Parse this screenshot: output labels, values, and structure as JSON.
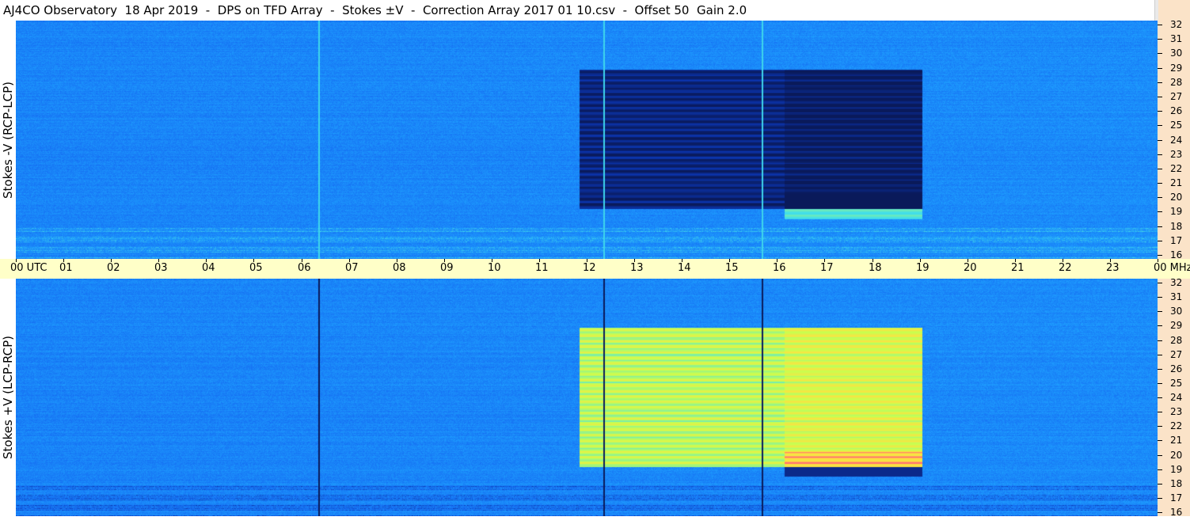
{
  "title": "AJ4CO Observatory  18 Apr 2019  -  DPS on TFD Array  -  Stokes ±V  -  Correction Array 2017 01 10.csv  -  Offset 50  Gain 2.0",
  "chart_data": [
    {
      "type": "heatmap",
      "name": "Stokes -V (RCP-LCP)",
      "ylabel": "Stokes -V (RCP-LCP)",
      "x_unit": "UTC",
      "y_unit": "MHz",
      "xlim": [
        0,
        24
      ],
      "ylim": [
        16,
        32
      ],
      "colormap": [
        "#0a1a5a",
        "#0b35b0",
        "#1465f0",
        "#1ea0ff",
        "#44e0e8",
        "#c8ff50",
        "#ffe040",
        "#ff3c8c"
      ],
      "events": [
        {
          "kind": "storm-block",
          "t_start": 11.85,
          "t_end": 19.05,
          "f_low": 19.2,
          "f_high": 28.9,
          "polarity": "negative"
        },
        {
          "kind": "storm-block-intense",
          "t_start": 16.15,
          "t_end": 19.05,
          "f_low": 18.5,
          "f_high": 28.9,
          "polarity": "negative"
        },
        {
          "kind": "vertical-line",
          "t": 6.35
        },
        {
          "kind": "vertical-line",
          "t": 12.35
        },
        {
          "kind": "vertical-line",
          "t": 15.68
        }
      ]
    },
    {
      "type": "heatmap",
      "name": "Stokes +V (LCP-RCP)",
      "ylabel": "Stokes +V (LCP-RCP)",
      "x_unit": "UTC",
      "y_unit": "MHz",
      "xlim": [
        0,
        24
      ],
      "ylim": [
        16,
        32
      ],
      "colormap": [
        "#0a1a5a",
        "#0b35b0",
        "#1465f0",
        "#1ea0ff",
        "#44e0e8",
        "#c8ff50",
        "#ffe040",
        "#ff3c8c"
      ],
      "events": [
        {
          "kind": "storm-block",
          "t_start": 11.85,
          "t_end": 19.05,
          "f_low": 19.2,
          "f_high": 28.9,
          "polarity": "positive"
        },
        {
          "kind": "storm-block-intense",
          "t_start": 16.15,
          "t_end": 19.05,
          "f_low": 18.5,
          "f_high": 28.9,
          "polarity": "positive"
        },
        {
          "kind": "vertical-line",
          "t": 6.35
        },
        {
          "kind": "vertical-line",
          "t": 12.35
        },
        {
          "kind": "vertical-line",
          "t": 15.68
        }
      ]
    }
  ],
  "time_axis": {
    "labels": [
      "00 UTC",
      "01",
      "02",
      "03",
      "04",
      "05",
      "06",
      "07",
      "08",
      "09",
      "10",
      "11",
      "12",
      "13",
      "14",
      "15",
      "16",
      "17",
      "18",
      "19",
      "20",
      "21",
      "22",
      "23",
      "00 MHz"
    ],
    "values": [
      0,
      1,
      2,
      3,
      4,
      5,
      6,
      7,
      8,
      9,
      10,
      11,
      12,
      13,
      14,
      15,
      16,
      17,
      18,
      19,
      20,
      21,
      22,
      23,
      24
    ]
  },
  "freq_axis": {
    "labels": [
      "32",
      "31",
      "30",
      "29",
      "28",
      "27",
      "26",
      "25",
      "24",
      "23",
      "22",
      "21",
      "20",
      "19",
      "18",
      "17",
      "16"
    ],
    "values": [
      32,
      31,
      30,
      29,
      28,
      27,
      26,
      25,
      24,
      23,
      22,
      21,
      20,
      19,
      18,
      17,
      16
    ]
  }
}
